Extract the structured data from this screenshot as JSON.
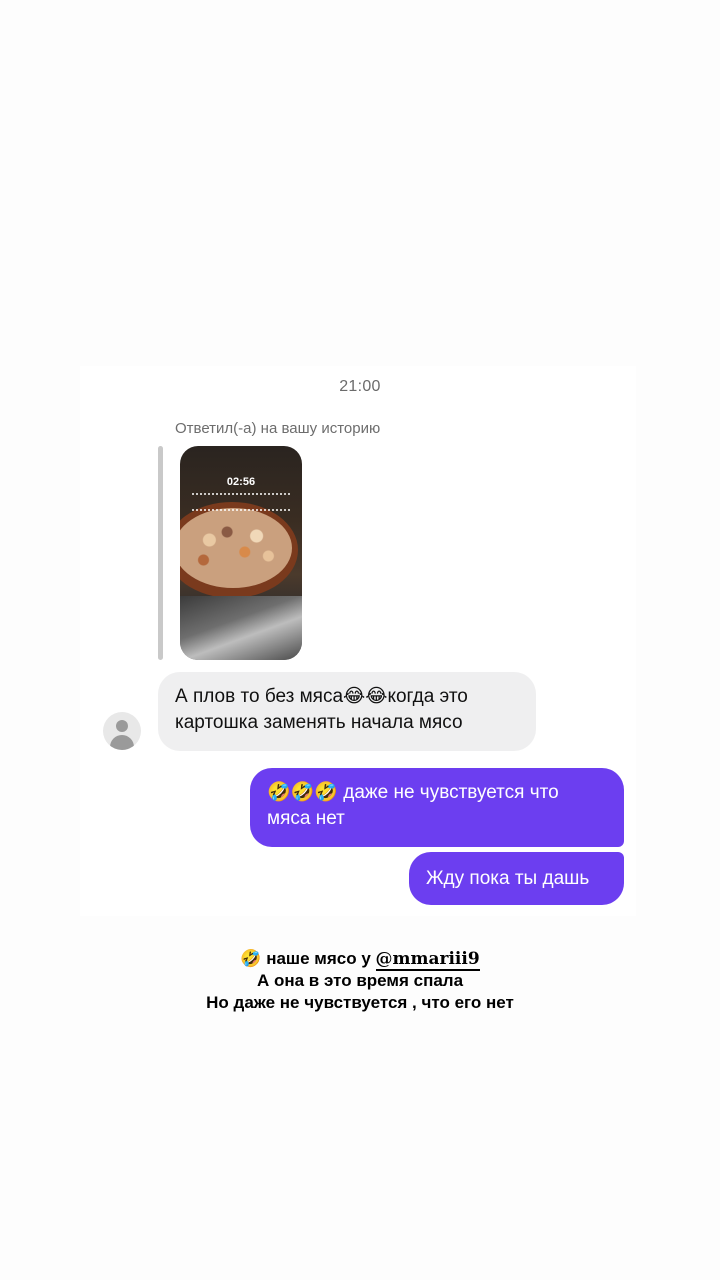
{
  "chat": {
    "time": "21:00",
    "reply_note": "Ответил(-а) на вашу историю",
    "story": {
      "time_overlay": "02:56"
    },
    "messages": [
      {
        "from": "them",
        "text": "А плов то без мяса😂😂когда это картошка заменять начала мясо"
      },
      {
        "from": "me",
        "text": "🤣🤣🤣 даже не чувствуется что мяса нет"
      },
      {
        "from": "me",
        "text": "Жду пока ты дашь"
      }
    ],
    "colors": {
      "outgoing_bubble": "#6c3ef0",
      "incoming_bubble": "#efeff0"
    }
  },
  "caption": {
    "line1_emoji": "🤣",
    "line1_text": "наше  мясо у",
    "mention": "@mmariii9",
    "line2": "А она в это время спала",
    "line3": "Но даже не чувствуется , что его нет"
  }
}
